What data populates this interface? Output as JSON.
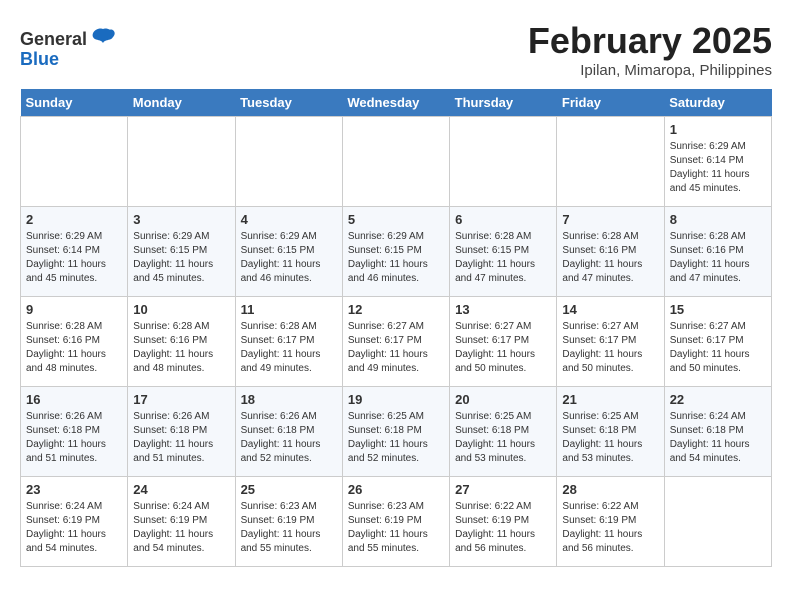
{
  "header": {
    "logo_general": "General",
    "logo_blue": "Blue",
    "month_year": "February 2025",
    "location": "Ipilan, Mimaropa, Philippines"
  },
  "days_of_week": [
    "Sunday",
    "Monday",
    "Tuesday",
    "Wednesday",
    "Thursday",
    "Friday",
    "Saturday"
  ],
  "weeks": [
    [
      {
        "day": "",
        "content": ""
      },
      {
        "day": "",
        "content": ""
      },
      {
        "day": "",
        "content": ""
      },
      {
        "day": "",
        "content": ""
      },
      {
        "day": "",
        "content": ""
      },
      {
        "day": "",
        "content": ""
      },
      {
        "day": "1",
        "content": "Sunrise: 6:29 AM\nSunset: 6:14 PM\nDaylight: 11 hours and 45 minutes."
      }
    ],
    [
      {
        "day": "2",
        "content": "Sunrise: 6:29 AM\nSunset: 6:14 PM\nDaylight: 11 hours and 45 minutes."
      },
      {
        "day": "3",
        "content": "Sunrise: 6:29 AM\nSunset: 6:15 PM\nDaylight: 11 hours and 45 minutes."
      },
      {
        "day": "4",
        "content": "Sunrise: 6:29 AM\nSunset: 6:15 PM\nDaylight: 11 hours and 46 minutes."
      },
      {
        "day": "5",
        "content": "Sunrise: 6:29 AM\nSunset: 6:15 PM\nDaylight: 11 hours and 46 minutes."
      },
      {
        "day": "6",
        "content": "Sunrise: 6:28 AM\nSunset: 6:15 PM\nDaylight: 11 hours and 47 minutes."
      },
      {
        "day": "7",
        "content": "Sunrise: 6:28 AM\nSunset: 6:16 PM\nDaylight: 11 hours and 47 minutes."
      },
      {
        "day": "8",
        "content": "Sunrise: 6:28 AM\nSunset: 6:16 PM\nDaylight: 11 hours and 47 minutes."
      }
    ],
    [
      {
        "day": "9",
        "content": "Sunrise: 6:28 AM\nSunset: 6:16 PM\nDaylight: 11 hours and 48 minutes."
      },
      {
        "day": "10",
        "content": "Sunrise: 6:28 AM\nSunset: 6:16 PM\nDaylight: 11 hours and 48 minutes."
      },
      {
        "day": "11",
        "content": "Sunrise: 6:28 AM\nSunset: 6:17 PM\nDaylight: 11 hours and 49 minutes."
      },
      {
        "day": "12",
        "content": "Sunrise: 6:27 AM\nSunset: 6:17 PM\nDaylight: 11 hours and 49 minutes."
      },
      {
        "day": "13",
        "content": "Sunrise: 6:27 AM\nSunset: 6:17 PM\nDaylight: 11 hours and 50 minutes."
      },
      {
        "day": "14",
        "content": "Sunrise: 6:27 AM\nSunset: 6:17 PM\nDaylight: 11 hours and 50 minutes."
      },
      {
        "day": "15",
        "content": "Sunrise: 6:27 AM\nSunset: 6:17 PM\nDaylight: 11 hours and 50 minutes."
      }
    ],
    [
      {
        "day": "16",
        "content": "Sunrise: 6:26 AM\nSunset: 6:18 PM\nDaylight: 11 hours and 51 minutes."
      },
      {
        "day": "17",
        "content": "Sunrise: 6:26 AM\nSunset: 6:18 PM\nDaylight: 11 hours and 51 minutes."
      },
      {
        "day": "18",
        "content": "Sunrise: 6:26 AM\nSunset: 6:18 PM\nDaylight: 11 hours and 52 minutes."
      },
      {
        "day": "19",
        "content": "Sunrise: 6:25 AM\nSunset: 6:18 PM\nDaylight: 11 hours and 52 minutes."
      },
      {
        "day": "20",
        "content": "Sunrise: 6:25 AM\nSunset: 6:18 PM\nDaylight: 11 hours and 53 minutes."
      },
      {
        "day": "21",
        "content": "Sunrise: 6:25 AM\nSunset: 6:18 PM\nDaylight: 11 hours and 53 minutes."
      },
      {
        "day": "22",
        "content": "Sunrise: 6:24 AM\nSunset: 6:18 PM\nDaylight: 11 hours and 54 minutes."
      }
    ],
    [
      {
        "day": "23",
        "content": "Sunrise: 6:24 AM\nSunset: 6:19 PM\nDaylight: 11 hours and 54 minutes."
      },
      {
        "day": "24",
        "content": "Sunrise: 6:24 AM\nSunset: 6:19 PM\nDaylight: 11 hours and 54 minutes."
      },
      {
        "day": "25",
        "content": "Sunrise: 6:23 AM\nSunset: 6:19 PM\nDaylight: 11 hours and 55 minutes."
      },
      {
        "day": "26",
        "content": "Sunrise: 6:23 AM\nSunset: 6:19 PM\nDaylight: 11 hours and 55 minutes."
      },
      {
        "day": "27",
        "content": "Sunrise: 6:22 AM\nSunset: 6:19 PM\nDaylight: 11 hours and 56 minutes."
      },
      {
        "day": "28",
        "content": "Sunrise: 6:22 AM\nSunset: 6:19 PM\nDaylight: 11 hours and 56 minutes."
      },
      {
        "day": "",
        "content": ""
      }
    ]
  ]
}
